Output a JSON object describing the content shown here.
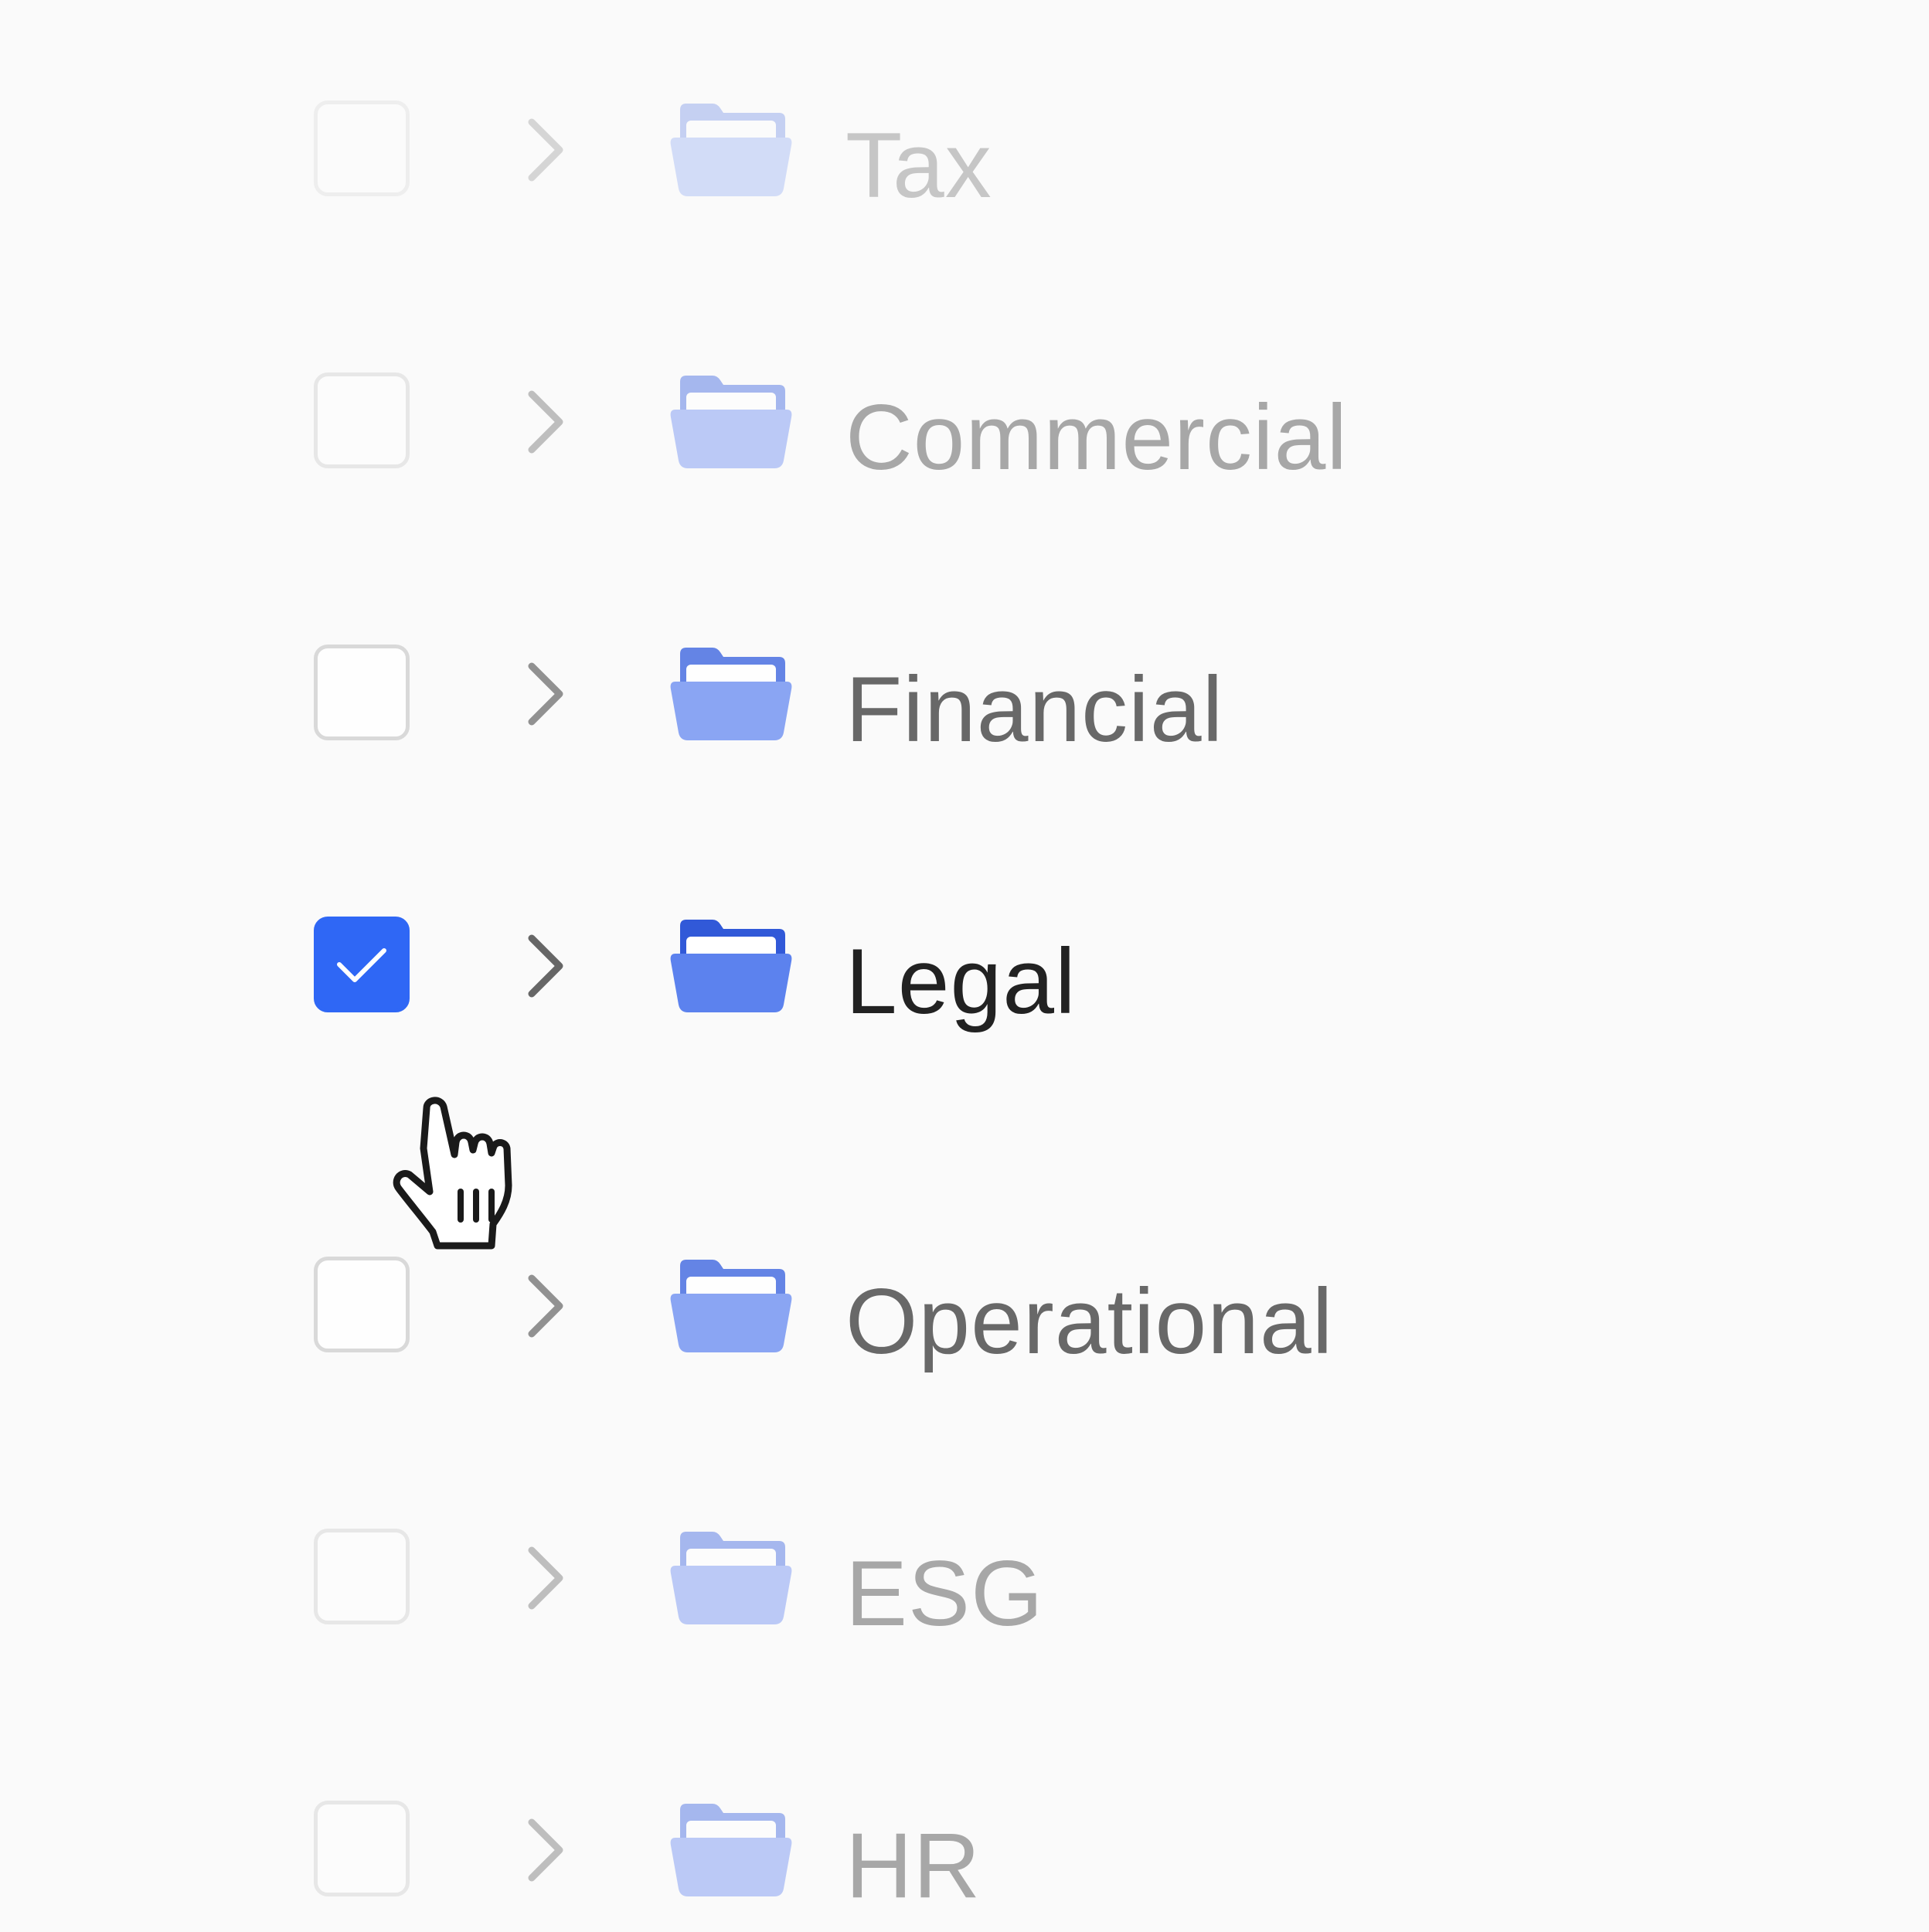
{
  "folders": [
    {
      "label": "Tax",
      "checked": false
    },
    {
      "label": "Commercial",
      "checked": false
    },
    {
      "label": "Financial",
      "checked": false
    },
    {
      "label": "Legal",
      "checked": true
    },
    {
      "label": "Operational",
      "checked": false
    },
    {
      "label": "ESG",
      "checked": false
    },
    {
      "label": "HR",
      "checked": false
    }
  ],
  "icons": {
    "checkbox": "checkbox-icon",
    "check": "checkmark-icon",
    "expand": "chevron-right-icon",
    "folder": "open-folder-icon",
    "cursor": "hand-pointer-icon"
  },
  "colors": {
    "accent": "#2f67f5",
    "background": "#fafafa",
    "folder_blue": "#5f86ef",
    "text_active": "#222222"
  }
}
